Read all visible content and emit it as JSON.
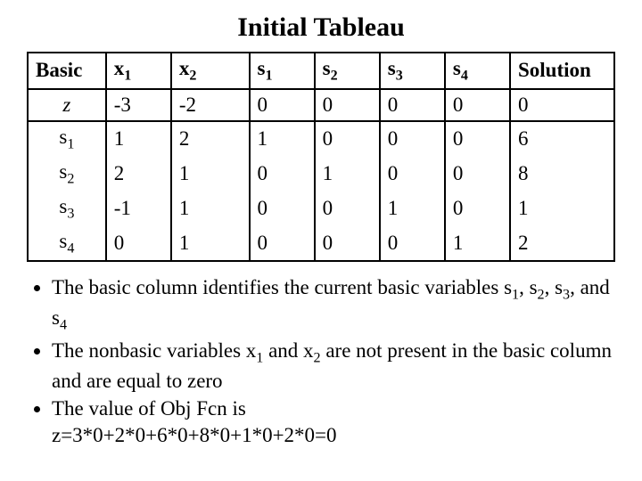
{
  "title": "Initial Tableau",
  "headers": {
    "basic": "Basic",
    "x1": "x",
    "x2": "x",
    "s1": "s",
    "s2": "s",
    "s3": "s",
    "s4": "s",
    "solution": "Solution"
  },
  "rows": [
    {
      "basic": "z",
      "x1": "-3",
      "x2": "-2",
      "s1": "0",
      "s2": "0",
      "s3": "0",
      "s4": "0",
      "solution": "0"
    },
    {
      "basic": "s1",
      "x1": "1",
      "x2": "2",
      "s1": "1",
      "s2": "0",
      "s3": "0",
      "s4": "0",
      "solution": "6"
    },
    {
      "basic": "s2",
      "x1": "2",
      "x2": "1",
      "s1": "0",
      "s2": "1",
      "s3": "0",
      "s4": "0",
      "solution": "8"
    },
    {
      "basic": "s3",
      "x1": "-1",
      "x2": "1",
      "s1": "0",
      "s2": "0",
      "s3": "1",
      "s4": "0",
      "solution": "1"
    },
    {
      "basic": "s4",
      "x1": "0",
      "x2": "1",
      "s1": "0",
      "s2": "0",
      "s3": "0",
      "s4": "1",
      "solution": "2"
    }
  ],
  "bullets": {
    "b1a": "The basic column identifies the current basic variables s",
    "b1b": ", s",
    "b1c": ", s",
    "b1d": ", and s",
    "b2a": "The nonbasic variables x",
    "b2b": " and x",
    "b2c": " are not present in the basic column and are equal to zero",
    "b3": "The value of Obj Fcn is"
  },
  "formula": "z=3*0+2*0+6*0+8*0+1*0+2*0=0",
  "chart_data": {
    "type": "table",
    "title": "Initial Tableau",
    "columns": [
      "Basic",
      "x1",
      "x2",
      "s1",
      "s2",
      "s3",
      "s4",
      "Solution"
    ],
    "rows": [
      [
        "z",
        -3,
        -2,
        0,
        0,
        0,
        0,
        0
      ],
      [
        "s1",
        1,
        2,
        1,
        0,
        0,
        0,
        6
      ],
      [
        "s2",
        2,
        1,
        0,
        1,
        0,
        0,
        8
      ],
      [
        "s3",
        -1,
        1,
        0,
        0,
        1,
        0,
        1
      ],
      [
        "s4",
        0,
        1,
        0,
        0,
        0,
        1,
        2
      ]
    ]
  }
}
